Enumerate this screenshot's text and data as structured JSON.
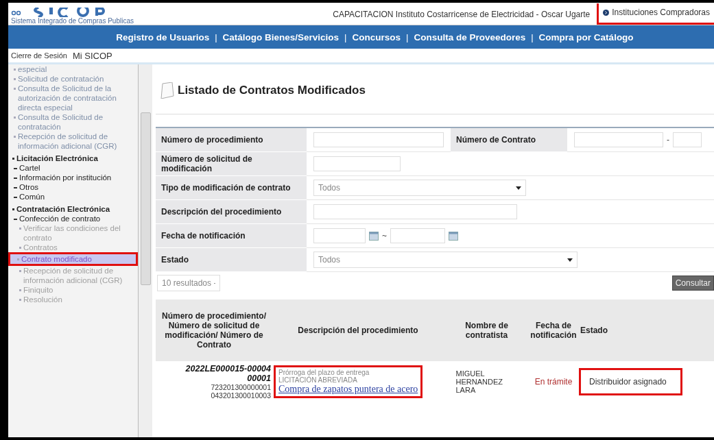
{
  "header": {
    "logo_subtitle": "Sistema Integrado de Compras Publicas",
    "user": "CAPACITACION Instituto Costarricense de Electricidad - Oscar Ugarte",
    "institutions_link": {
      "label": "Instituciones Compradoras",
      "highlighted": true
    }
  },
  "nav": {
    "items": [
      "Registro de Usuarios",
      "Catálogo Bienes/Servicios",
      "Concursos",
      "Consulta de Proveedores",
      "Compra por Catálogo"
    ],
    "separator": "|"
  },
  "subnav": [
    "Cierre de Sesión",
    "Mi SICOP"
  ],
  "sidebar": {
    "items": [
      {
        "label": "especial",
        "kind": "link",
        "selected": false,
        "highlighted": false
      },
      {
        "label": "Solicitud de contratación",
        "kind": "link",
        "selected": false,
        "highlighted": false
      },
      {
        "label": "Consulta de Solicitud de la autorización de contratación directa especial",
        "kind": "link",
        "selected": false,
        "highlighted": false
      },
      {
        "label": "Consulta de Solicitud de contratación",
        "kind": "link",
        "selected": false,
        "highlighted": false
      },
      {
        "label": "Recepción de solicitud de información adicional (CGR)",
        "kind": "link",
        "selected": false,
        "highlighted": false
      },
      {
        "label": "Licitación Electrónica",
        "kind": "section",
        "selected": false,
        "highlighted": false,
        "children": [
          {
            "label": "Cartel",
            "kind": "sub",
            "selected": false,
            "highlighted": false
          },
          {
            "label": "Información por institución",
            "kind": "sub",
            "selected": false,
            "highlighted": false
          },
          {
            "label": "Otros",
            "kind": "sub",
            "selected": false,
            "highlighted": false
          },
          {
            "label": "Común",
            "kind": "sub",
            "selected": false,
            "highlighted": false
          }
        ]
      },
      {
        "label": "Contratación Electrónica",
        "kind": "section",
        "selected": false,
        "highlighted": false,
        "children": [
          {
            "label": "Confección de contrato",
            "kind": "sub",
            "selected": false,
            "highlighted": false,
            "children": [
              {
                "label": "Verificar las condiciones del contrato",
                "kind": "leaf",
                "selected": false,
                "highlighted": false
              },
              {
                "label": "Contratos",
                "kind": "leaf",
                "selected": false,
                "highlighted": false
              },
              {
                "label": "Contrato modificado",
                "kind": "leaf",
                "selected": true,
                "highlighted": true
              },
              {
                "label": "Recepción de solicitud de información adicional (CGR)",
                "kind": "leaf",
                "selected": false,
                "highlighted": false
              },
              {
                "label": "Finiquito",
                "kind": "leaf",
                "selected": false,
                "highlighted": false
              },
              {
                "label": "Resolución",
                "kind": "leaf",
                "selected": false,
                "highlighted": false
              }
            ]
          }
        ]
      }
    ]
  },
  "page_title": "Listado de Contratos Modificados",
  "filters": {
    "procedure_number": {
      "label": "Número de procedimiento"
    },
    "contract_number": {
      "label": "Número de Contrato",
      "separator": "-"
    },
    "request_number": {
      "label": "Número de solicitud de modificación"
    },
    "modification_type": {
      "label": "Tipo de modificación de contrato",
      "value": "Todos"
    },
    "description": {
      "label": "Descripción del procedimiento"
    },
    "notification_date": {
      "label": "Fecha de notificación",
      "separator": "~"
    },
    "status": {
      "label": "Estado",
      "value": "Todos"
    }
  },
  "page_size": "10 resultados",
  "search_button": "Consultar",
  "table": {
    "columns": [
      "Número de procedimiento/ Número de solicitud de modificación/ Número de Contrato",
      "Descripción del procedimiento",
      "Nombre de contratista",
      "Fecha de notificación",
      "Estado"
    ],
    "rows": [
      {
        "procedure": "2022LE000015-00004",
        "request": "00001",
        "contract_lines": [
          "723201300000001",
          "043201300010003"
        ],
        "description": {
          "type": "Prórroga del plazo de entrega",
          "category": "LICITACIÓN ABREVIADA",
          "title": "Compra de zapatos puntera de acero",
          "highlighted": true
        },
        "contractor": "MIGUEL HERNANDEZ LARA",
        "date": "En trámite",
        "status": {
          "label": "Distribuidor asignado",
          "highlighted": true
        }
      }
    ]
  }
}
